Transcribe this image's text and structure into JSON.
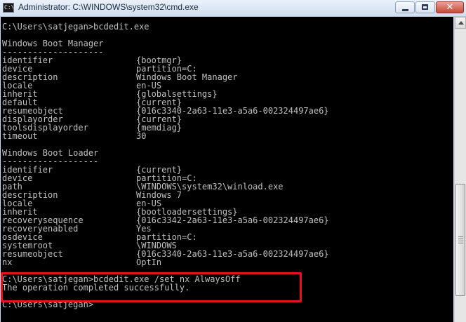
{
  "window": {
    "title": "Administrator: C:\\WINDOWS\\system32\\cmd.exe",
    "icon": "cmd-icon",
    "app_icon_text": "C:\\"
  },
  "console": {
    "prompt1": "C:\\Users\\satjegan>bcdedit.exe",
    "manager_heading": "Windows Boot Manager",
    "manager_rule": "--------------------",
    "manager_entries": [
      {
        "key": "identifier",
        "value": "{bootmgr}"
      },
      {
        "key": "device",
        "value": "partition=C:"
      },
      {
        "key": "description",
        "value": "Windows Boot Manager"
      },
      {
        "key": "locale",
        "value": "en-US"
      },
      {
        "key": "inherit",
        "value": "{globalsettings}"
      },
      {
        "key": "default",
        "value": "{current}"
      },
      {
        "key": "resumeobject",
        "value": "{016c3340-2a63-11e3-a5a6-002324497ae6}"
      },
      {
        "key": "displayorder",
        "value": "{current}"
      },
      {
        "key": "toolsdisplayorder",
        "value": "{memdiag}"
      },
      {
        "key": "timeout",
        "value": "30"
      }
    ],
    "loader_heading": "Windows Boot Loader",
    "loader_rule": "-------------------",
    "loader_entries": [
      {
        "key": "identifier",
        "value": "{current}"
      },
      {
        "key": "device",
        "value": "partition=C:"
      },
      {
        "key": "path",
        "value": "\\WINDOWS\\system32\\winload.exe"
      },
      {
        "key": "description",
        "value": "Windows 7"
      },
      {
        "key": "locale",
        "value": "en-US"
      },
      {
        "key": "inherit",
        "value": "{bootloadersettings}"
      },
      {
        "key": "recoverysequence",
        "value": "{016c3342-2a63-11e3-a5a6-002324497ae6}"
      },
      {
        "key": "recoveryenabled",
        "value": "Yes"
      },
      {
        "key": "osdevice",
        "value": "partition=C:"
      },
      {
        "key": "systemroot",
        "value": "\\WINDOWS"
      },
      {
        "key": "resumeobject",
        "value": "{016c3340-2a63-11e3-a5a6-002324497ae6}"
      },
      {
        "key": "nx",
        "value": "OptIn"
      }
    ],
    "prompt2": "C:\\Users\\satjegan>bcdedit.exe /set nx AlwaysOff",
    "result": "The operation completed successfully.",
    "prompt3": "C:\\Users\\satjegan>"
  },
  "colors": {
    "console_bg": "#000000",
    "console_text": "#c0c0c0",
    "highlight": "#e8101d"
  }
}
